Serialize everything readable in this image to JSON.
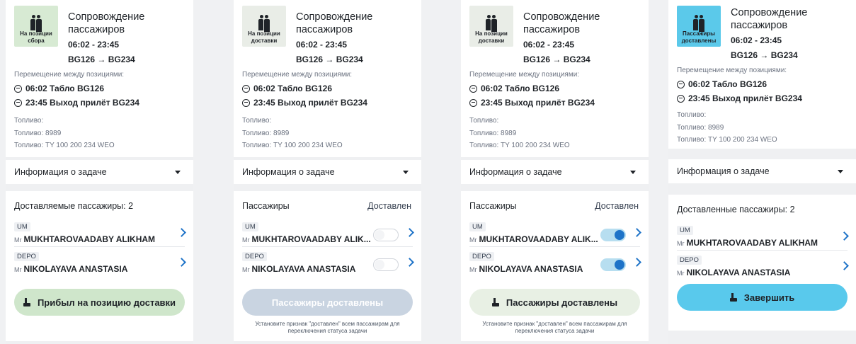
{
  "common": {
    "title": "Сопровождение пассажиров",
    "time": "06:02 - 23:45",
    "route": "BG126 → BG234",
    "move_label": "Перемещение между позициями:",
    "move_from": "06:02 Табло BG126",
    "move_to": "23:45 Выход прилёт BG234",
    "fuel1": "Топливо:",
    "fuel2": "Топливо: 8989",
    "fuel3": "Топливо: TY 100 200 234 WEO",
    "info": "Информация о задаче",
    "pax1_tag": "UM",
    "pax2_tag": "DEPO",
    "mr": "Mr",
    "pax1_name": "MUKHTAROVAADABY ALIKHAM",
    "pax1_name_trunc": "MUKHTAROVAADABY ALIK...",
    "pax2_name": "NIKOLAYAVA ANASTASIA",
    "hint": "Установите признак \"доставлен\" всем пассажирам для переключения статуса задачи"
  },
  "panels": [
    {
      "tile_label": "На позиции сбора",
      "tile_color": "#d7ead3",
      "pax_header": "Доставляемые пассажиры:",
      "pax_count": "2",
      "button": "Прибыл на позицию доставки",
      "button_color": "#cfe6cb",
      "toggles": "none"
    },
    {
      "tile_label": "На позиции доставки",
      "tile_color": "#e9ede7",
      "pax_header": "Пассажиры",
      "delivered_header": "Доставлен",
      "button": "Пассажиры доставлены",
      "button_color": "#c9d4e1",
      "toggles": "off"
    },
    {
      "tile_label": "На позиции доставки",
      "tile_color": "#e9ede7",
      "pax_header": "Пассажиры",
      "delivered_header": "Доставлен",
      "button": "Пассажиры доставлены",
      "button_color": "#e8f0e4",
      "toggles": "on"
    },
    {
      "tile_label": "Пассажиры доставлены",
      "tile_color": "#5bc9ea",
      "pax_header": "Доставленные пассажиры:",
      "pax_count": "2",
      "button": "Завершить",
      "button_color": "#59c9ec",
      "toggles": "none"
    }
  ]
}
